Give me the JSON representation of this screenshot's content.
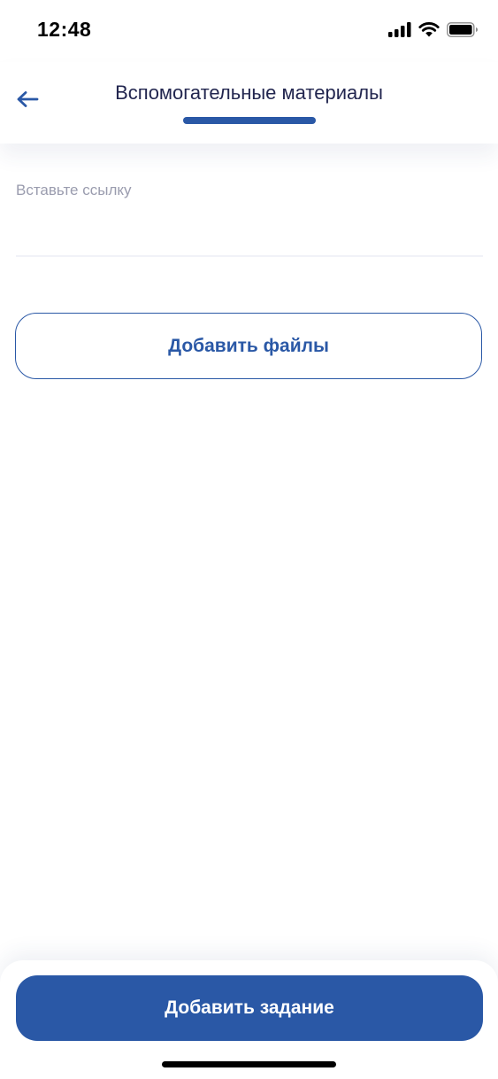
{
  "status_bar": {
    "time": "12:48",
    "icons": [
      "cellular-signal-icon",
      "wifi-icon",
      "battery-icon"
    ]
  },
  "header": {
    "title": "Вспомогательные материалы",
    "back_icon": "arrow-left-icon",
    "accent_color": "#2a58a6"
  },
  "link_field": {
    "placeholder": "Вставьте ссылку",
    "value": ""
  },
  "add_files_button": {
    "label": "Добавить файлы"
  },
  "submit_button": {
    "label": "Добавить задание"
  }
}
